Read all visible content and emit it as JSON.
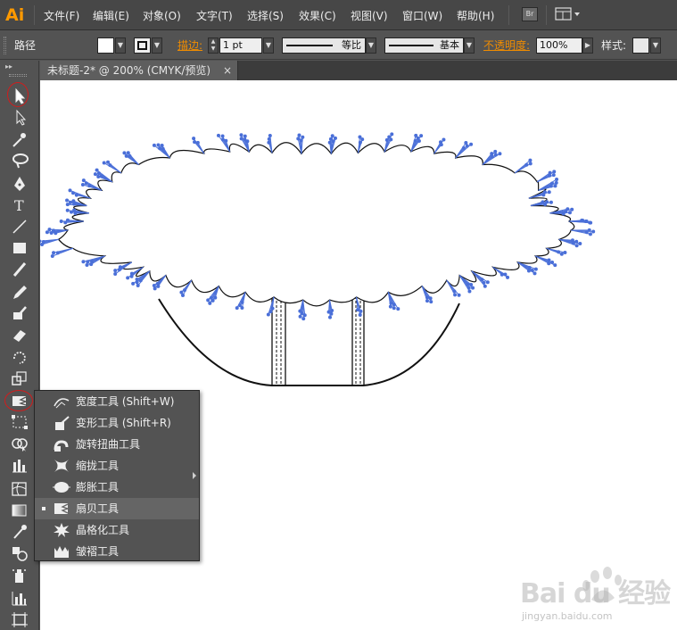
{
  "app": {
    "logo": "Ai",
    "br_badge": "Br"
  },
  "menu": {
    "items": [
      "文件(F)",
      "编辑(E)",
      "对象(O)",
      "文字(T)",
      "选择(S)",
      "效果(C)",
      "视图(V)",
      "窗口(W)",
      "帮助(H)"
    ]
  },
  "control": {
    "selection_label": "路径",
    "stroke_link": "描边:",
    "stroke_weight": "1 pt",
    "profile_label": "等比",
    "brush_label": "基本",
    "opacity_link": "不透明度:",
    "opacity_value": "100%",
    "style_label": "样式:"
  },
  "document": {
    "tab_title": "未标题-2* @ 200% (CMYK/预览)",
    "close_glyph": "×"
  },
  "flyout": {
    "items": [
      {
        "label": "宽度工具  (Shift+W)",
        "icon": "width-tool-icon",
        "active": false
      },
      {
        "label": "变形工具  (Shift+R)",
        "icon": "warp-tool-icon",
        "active": false
      },
      {
        "label": "旋转扭曲工具",
        "icon": "twirl-tool-icon",
        "active": false
      },
      {
        "label": "缩拢工具",
        "icon": "pucker-tool-icon",
        "active": false
      },
      {
        "label": "膨胀工具",
        "icon": "bloat-tool-icon",
        "active": false
      },
      {
        "label": "扇贝工具",
        "icon": "scallop-tool-icon",
        "active": true
      },
      {
        "label": "晶格化工具",
        "icon": "crystallize-tool-icon",
        "active": false
      },
      {
        "label": "皱褶工具",
        "icon": "wrinkle-tool-icon",
        "active": false
      }
    ]
  },
  "watermark": {
    "brand": "Bai du 经验",
    "url": "jingyan.baidu.com"
  },
  "colors": {
    "accent_orange": "#ff9a00",
    "link_orange": "#f08c00",
    "annotation_red": "#d21c1c",
    "anchor_blue": "#4a6fd8",
    "canvas": "#ffffff"
  }
}
